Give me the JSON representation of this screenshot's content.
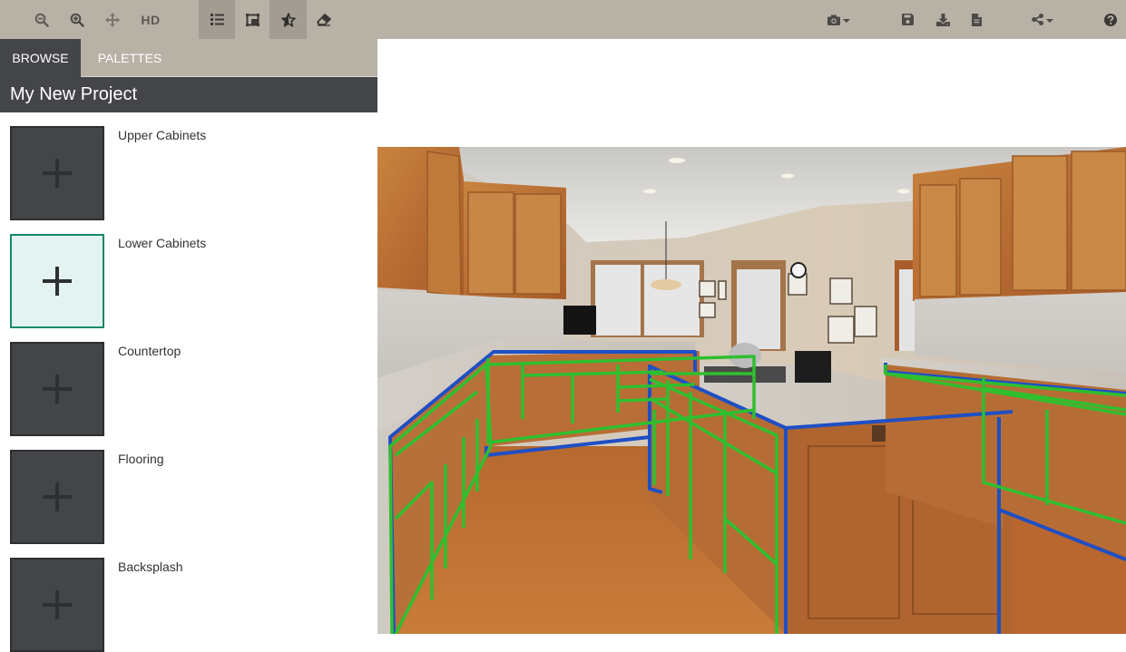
{
  "toolbar": {
    "left_buttons": [
      {
        "name": "zoom-out",
        "icon": "zoom-out-icon"
      },
      {
        "name": "zoom-in",
        "icon": "zoom-in-icon"
      },
      {
        "name": "pan",
        "icon": "move-icon"
      },
      {
        "name": "hd",
        "label": "HD"
      }
    ],
    "mode_buttons": [
      {
        "name": "list-view",
        "icon": "list-icon",
        "active": true
      },
      {
        "name": "compare",
        "icon": "picture-in-picture-icon",
        "active": false
      },
      {
        "name": "favorites",
        "icon": "star-icon",
        "active": true
      },
      {
        "name": "eraser",
        "icon": "eraser-icon",
        "active": false
      }
    ],
    "right_buttons": [
      {
        "name": "camera",
        "icon": "camera-icon",
        "dropdown": true
      },
      {
        "name": "save",
        "icon": "floppy-disk-icon"
      },
      {
        "name": "download",
        "icon": "download-icon"
      },
      {
        "name": "document",
        "icon": "document-icon"
      },
      {
        "name": "share",
        "icon": "share-icon",
        "dropdown": true
      },
      {
        "name": "help",
        "icon": "question-circle-icon"
      }
    ],
    "hd_label": "HD"
  },
  "sidebar": {
    "tabs": [
      {
        "label": "BROWSE",
        "active": true
      },
      {
        "label": "PALETTES",
        "active": false
      }
    ],
    "project_title": "My New Project",
    "categories": [
      {
        "label": "Upper Cabinets",
        "selected": false
      },
      {
        "label": "Lower Cabinets",
        "selected": true
      },
      {
        "label": "Countertop",
        "selected": false
      },
      {
        "label": "Flooring",
        "selected": false
      },
      {
        "label": "Backsplash",
        "selected": false
      }
    ]
  },
  "canvas": {
    "image_description": "Kitchen photo with wood cabinets, granite countertops and hardwood floor; lower cabinets outlined",
    "overlay_colors": {
      "region_outline": "#1f4fc4",
      "segment_outline": "#2fbf2f"
    }
  },
  "colors": {
    "toolbar_bg": "#b8b1a6",
    "toolbar_active": "#a39c93",
    "dark_panel": "#444548",
    "selected_accent": "#17886c",
    "selected_bg": "#e3f3ef"
  }
}
